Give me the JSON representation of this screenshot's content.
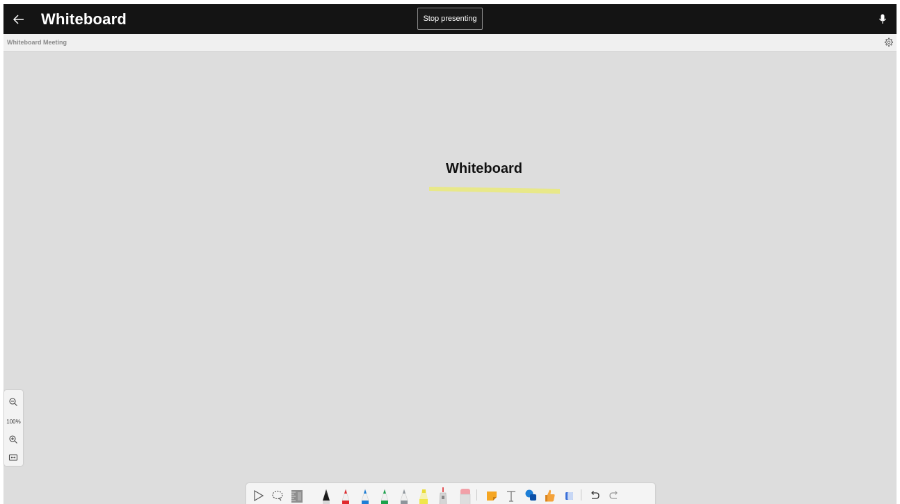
{
  "app": {
    "title": "Whiteboard"
  },
  "header": {
    "stop_presenting_label": "Stop presenting"
  },
  "subheader": {
    "meeting_name": "Whiteboard Meeting"
  },
  "canvas": {
    "text": "Whiteboard",
    "highlight_color": "#e8e884"
  },
  "zoom": {
    "level": "100%"
  },
  "icons": {
    "back": "arrow-left-icon",
    "mic": "microphone-icon",
    "settings": "gear-icon",
    "zoom_out": "zoom-out-icon",
    "zoom_in": "zoom-in-icon",
    "fit": "fit-screen-icon"
  },
  "toolbar": {
    "tools": [
      "select",
      "lasso",
      "ruler",
      "pen-black",
      "pen-red",
      "pen-blue",
      "pen-green",
      "pen-gray",
      "highlighter-yellow",
      "laser-pointer",
      "eraser",
      "sticky-note",
      "text",
      "shapes",
      "reactions",
      "stickers",
      "undo",
      "redo"
    ],
    "pen_colors": {
      "black": "#1a1a1a",
      "red": "#e0292d",
      "blue": "#1d7ed6",
      "green": "#1aa24b",
      "gray": "#8e959b",
      "highlighter": "#f0e64a"
    }
  }
}
